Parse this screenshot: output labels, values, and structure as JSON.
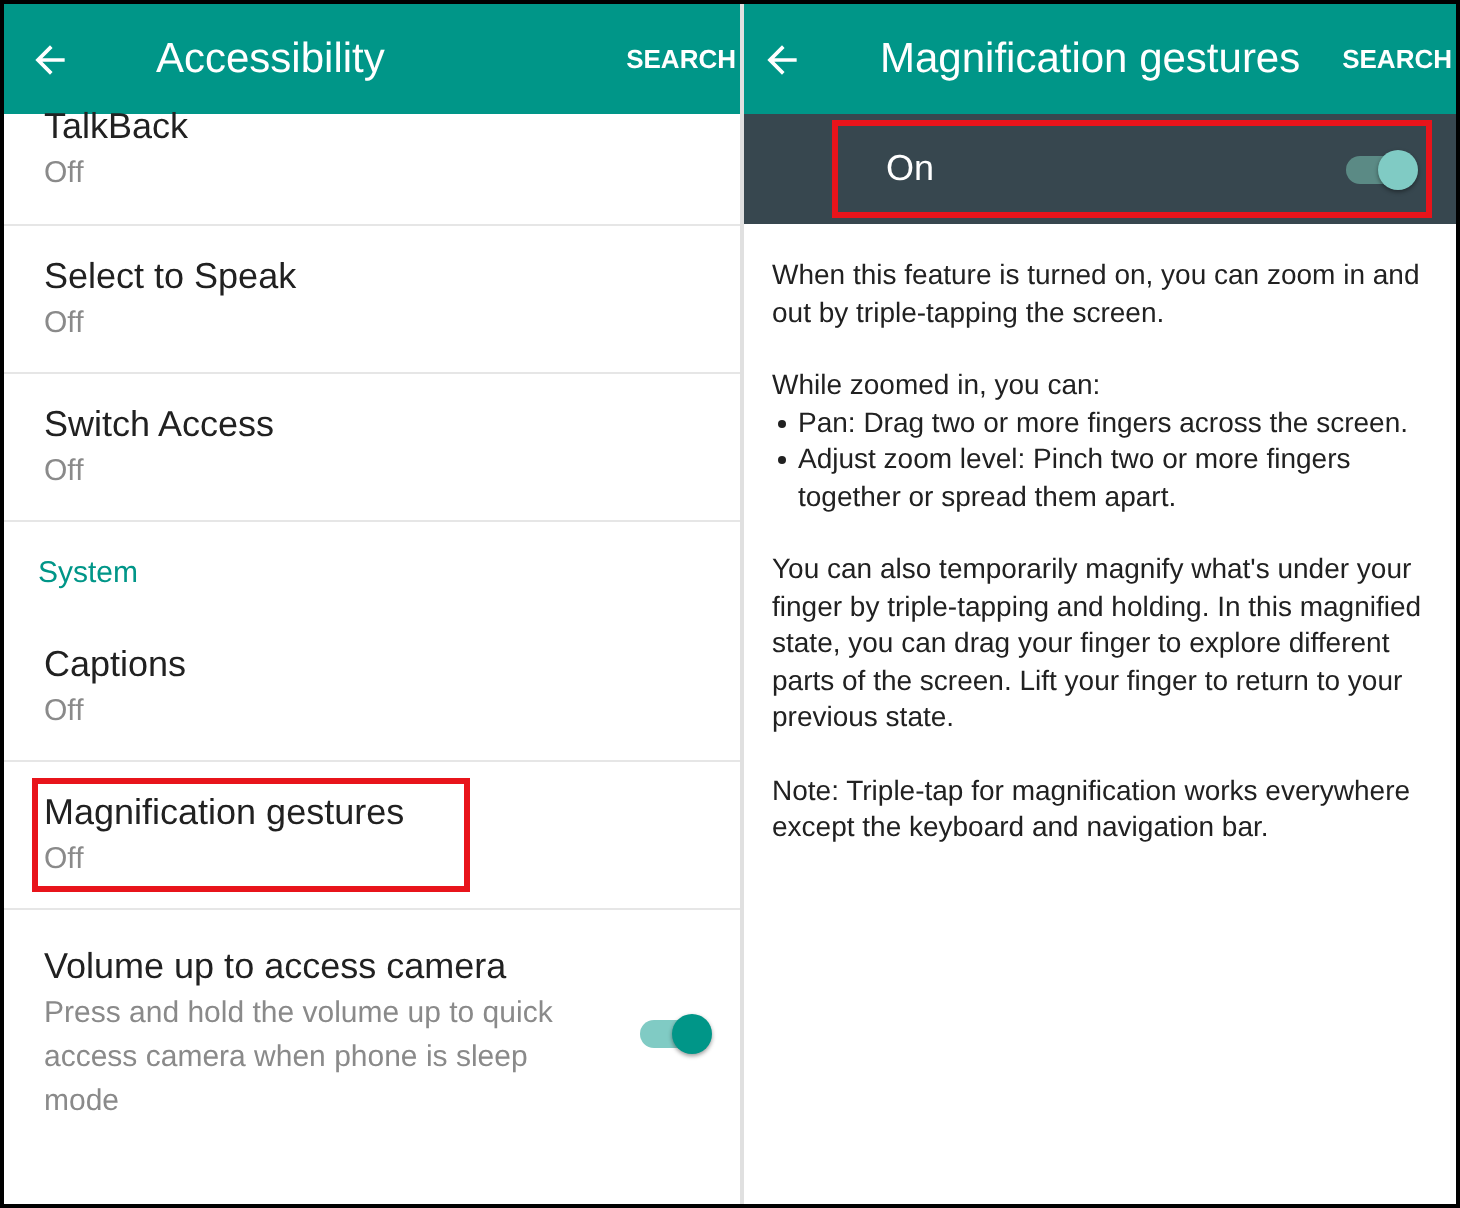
{
  "panels": [
    {
      "kind": "list",
      "title": "Accessibility",
      "action": "SEARCH",
      "items": [
        {
          "kind": "setting",
          "title": "TalkBack",
          "summary": "Off",
          "highlighted": false
        },
        {
          "kind": "setting",
          "title": "Select to Speak",
          "summary": "Off",
          "highlighted": false
        },
        {
          "kind": "setting",
          "title": "Switch Access",
          "summary": "Off",
          "highlighted": false
        },
        {
          "kind": "header",
          "title": "System"
        },
        {
          "kind": "setting",
          "title": "Captions",
          "summary": "Off",
          "highlighted": false
        },
        {
          "kind": "setting",
          "title": "Magnification gestures",
          "summary": "Off",
          "highlighted": true
        },
        {
          "kind": "toggle",
          "title": "Volume up to access camera",
          "summary": "Press and hold the volume up to quick access camera when phone is sleep mode",
          "on": true,
          "highlighted": false
        }
      ]
    },
    {
      "kind": "detail",
      "title": "Magnification gestures",
      "action": "SEARCH",
      "master": {
        "label": "On",
        "on": true,
        "highlighted": true
      },
      "body": [
        {
          "kind": "paragraph",
          "text": "When this feature is turned on, you can zoom in and out by triple-tapping the screen."
        },
        {
          "kind": "lead",
          "text": "While zoomed in, you can:"
        },
        {
          "kind": "bullet",
          "text": "Pan: Drag two or more fingers across the screen."
        },
        {
          "kind": "bullet",
          "text": "Adjust zoom level: Pinch two or more fingers together or spread them apart."
        },
        {
          "kind": "paragraph",
          "text": "You can also temporarily magnify what's under your finger by triple-tapping and holding. In this magnified state, you can drag your finger to explore different parts of the screen. Lift your finger to return to your previous state."
        },
        {
          "kind": "paragraph",
          "text": "Note: Triple-tap for magnification works everywhere except the keyboard and navigation bar."
        }
      ]
    }
  ]
}
